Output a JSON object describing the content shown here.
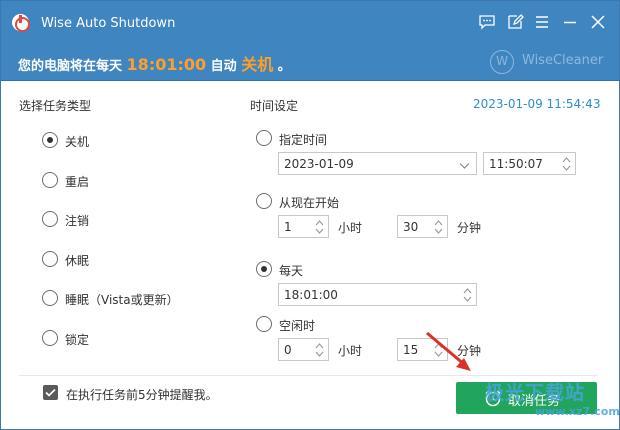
{
  "window": {
    "title": "Wise Auto Shutdown",
    "brand": "WiseCleaner",
    "brand_logo_letter": "W",
    "colors": {
      "titlebar": "#3f85c0",
      "accent": "#ff9f2a",
      "button": "#21a55c",
      "datetime": "#2a8fd0"
    }
  },
  "titlebar_buttons": [
    "feedback-icon",
    "edit-icon",
    "menu-icon",
    "minimize-icon",
    "close-icon"
  ],
  "banner": {
    "prefix": "您的电脑将在每天",
    "time": "18:01:00",
    "middle": "自动",
    "action": "关机",
    "suffix": "。"
  },
  "task_type": {
    "label": "选择任务类型",
    "options": [
      "关机",
      "重启",
      "注销",
      "休眠",
      "睡眠（Vista或更新）",
      "锁定"
    ],
    "selected": "关机"
  },
  "time_setting": {
    "label": "时间设定",
    "current_datetime": "2023-01-09 11:54:43",
    "specific_time": {
      "label": "指定时间",
      "date": "2023-01-09",
      "time": "11:50:07"
    },
    "from_now": {
      "label": "从现在开始",
      "hours": "1",
      "hours_unit": "小时",
      "minutes": "30",
      "minutes_unit": "分钟"
    },
    "daily": {
      "label": "每天",
      "time": "18:01:00",
      "selected": true
    },
    "idle": {
      "label": "空闲时",
      "hours": "0",
      "hours_unit": "小时",
      "minutes": "15",
      "minutes_unit": "分钟"
    }
  },
  "reminder": {
    "label": "在执行任务前5分钟提醒我。",
    "checked": true
  },
  "cancel_button": {
    "label": "取消任务"
  },
  "watermark": {
    "text": "极光下载站",
    "url": "www.xz7.com"
  }
}
